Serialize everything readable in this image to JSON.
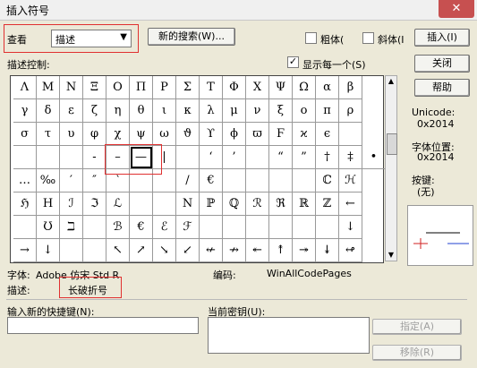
{
  "window": {
    "title": "插入符号",
    "close_label": "✕"
  },
  "toolbar": {
    "view_label": "查看",
    "view_value": "描述",
    "new_search_label": "新的搜索(W)...",
    "bold_label": "粗体(",
    "italic_label": "斜体(I",
    "insert_label": "插入(I)"
  },
  "desc_control_label": "描述控制:",
  "show_each_label": "显示每一个(S)",
  "side": {
    "close_label": "关闭",
    "help_label": "帮助",
    "unicode_label": "Unicode:",
    "unicode_value": "0x2014",
    "charpos_label": "字体位置:",
    "charpos_value": "0x2014",
    "key_label": "按键:",
    "key_value": "(无)"
  },
  "symbols": [
    [
      "Λ",
      "M",
      "N",
      "Ξ",
      "O",
      "Π",
      "P",
      "Σ",
      "T",
      "Φ",
      "X",
      "Ψ",
      "Ω",
      "α",
      "β"
    ],
    [
      "γ",
      "δ",
      "ε",
      "ζ",
      "η",
      "θ",
      "ι",
      "κ",
      "λ",
      "μ",
      "ν",
      "ξ",
      "ο",
      "π",
      "ρ"
    ],
    [
      "σ",
      "τ",
      "υ",
      "φ",
      "χ",
      "ψ",
      "ω",
      "ϑ",
      "ϒ",
      "ϕ",
      "ϖ",
      "Ϝ",
      "ϰ",
      "ϵ",
      ""
    ],
    [
      "",
      "",
      "",
      "-",
      "–",
      "—",
      "|",
      "",
      "‘",
      "’",
      "",
      "“",
      "”",
      "†",
      "‡",
      "•"
    ],
    [
      "…",
      "‰",
      "′",
      "″",
      "‵",
      "",
      "",
      "/",
      "€",
      "",
      "",
      "",
      "",
      "ℂ",
      "ℋ"
    ],
    [
      "ℌ",
      "H",
      "ℐ",
      "ℑ",
      "ℒ",
      "",
      "",
      "N",
      "ℙ",
      "ℚ",
      "ℛ",
      "ℜ",
      "ℝ",
      "ℤ",
      "←"
    ],
    [
      "",
      "Ʊ",
      "ℶ",
      "",
      "ℬ",
      "€",
      "ℰ",
      "ℱ",
      "",
      "",
      "",
      "",
      "",
      "",
      "↓"
    ],
    [
      "→",
      "↓",
      "",
      "",
      "↖",
      "↗",
      "↘",
      "↙",
      "↚",
      "↛",
      "↞",
      "↟",
      "↠",
      "↡",
      "↫"
    ]
  ],
  "selected": {
    "row": 3,
    "col": 5
  },
  "font_label": "字体:",
  "font_value": "Adobe 仿宋 Std R",
  "encoding_label": "编码:",
  "encoding_value": "WinAllCodePages",
  "desc_label": "描述:",
  "desc_value": "长破折号",
  "shortcut_label": "输入新的快捷键(N):",
  "current_key_label": "当前密钥(U):",
  "assign_label": "指定(A)",
  "remove_label": "移除(R)"
}
